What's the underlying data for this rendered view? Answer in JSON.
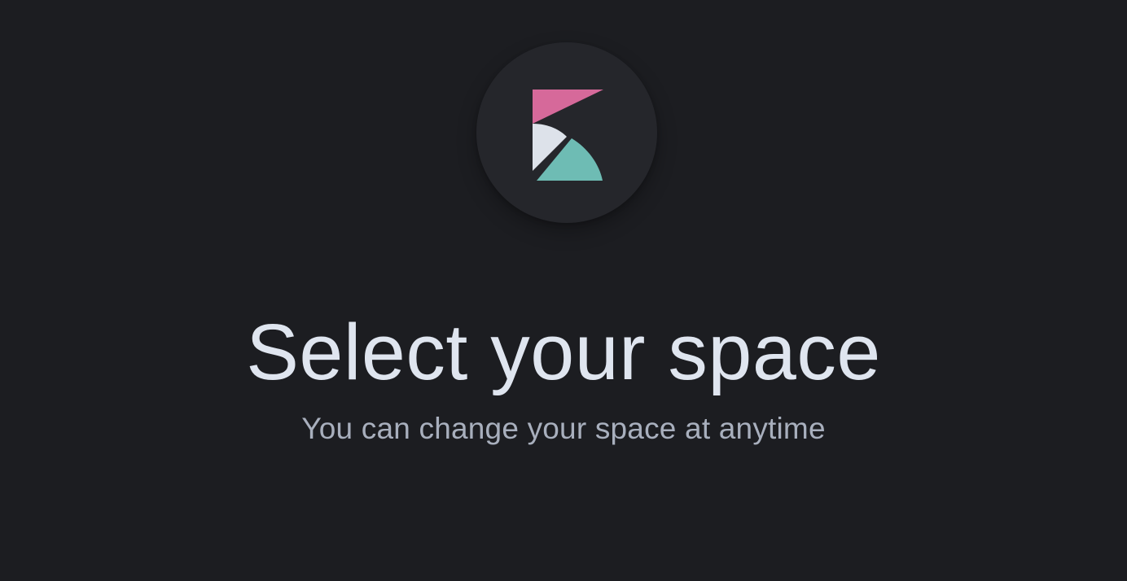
{
  "header": {
    "logo_icon": "kibana-logo-icon",
    "title": "Select your space",
    "subtitle": "You can change your space at anytime"
  },
  "colors": {
    "background": "#1c1d21",
    "logo_pink": "#d6699a",
    "logo_light": "#dde2ea",
    "logo_teal": "#6ebcb4"
  }
}
